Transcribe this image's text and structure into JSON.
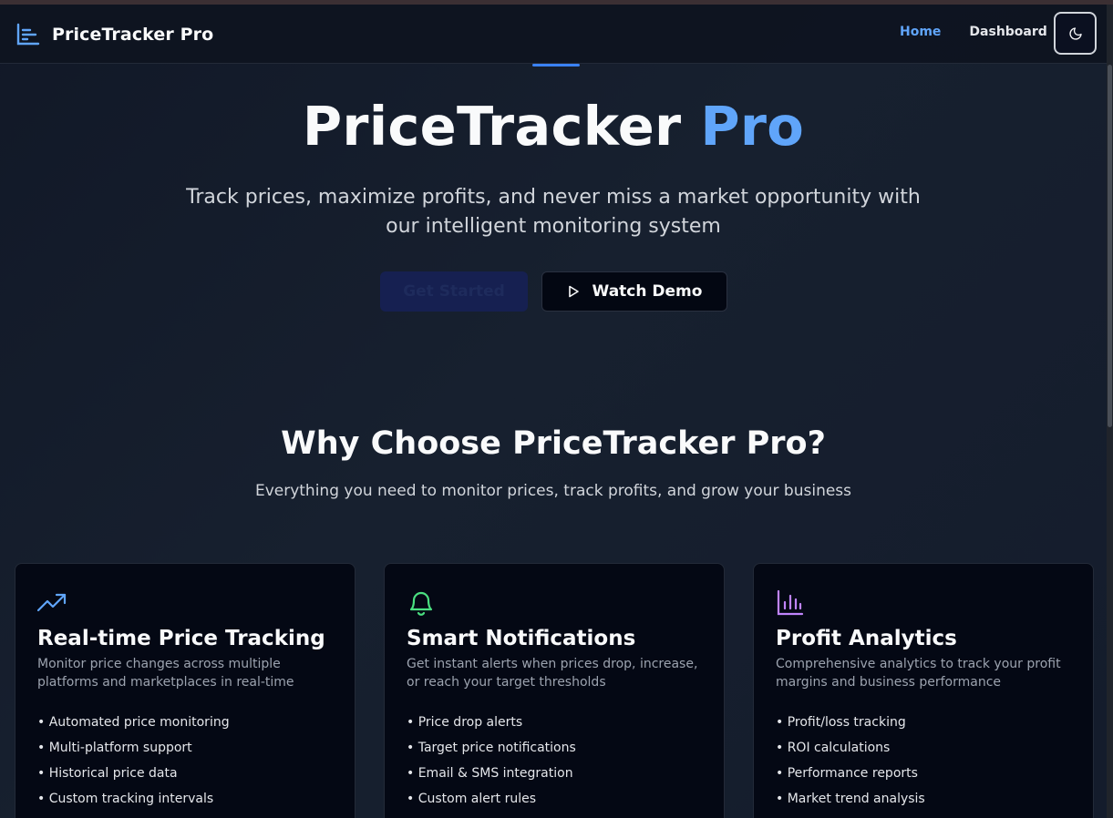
{
  "brand": {
    "name": "PriceTracker Pro"
  },
  "nav": {
    "home": "Home",
    "dashboard": "Dashboard"
  },
  "hero": {
    "title_main": "PriceTracker",
    "title_accent": "Pro",
    "subtitle": "Track prices, maximize profits, and never miss a market opportunity with our intelligent monitoring system",
    "cta_primary": "Get Started",
    "cta_secondary": "Watch Demo"
  },
  "features": {
    "title": "Why Choose PriceTracker Pro?",
    "subtitle": "Everything you need to monitor prices, track profits, and grow your business",
    "cards": [
      {
        "icon": "trending-up-icon",
        "title": "Real-time Price Tracking",
        "description": "Monitor price changes across multiple platforms and marketplaces in real-time",
        "items": [
          "• Automated price monitoring",
          "• Multi-platform support",
          "• Historical price data",
          "• Custom tracking intervals"
        ]
      },
      {
        "icon": "bell-icon",
        "title": "Smart Notifications",
        "description": "Get instant alerts when prices drop, increase, or reach your target thresholds",
        "items": [
          "• Price drop alerts",
          "• Target price notifications",
          "• Email & SMS integration",
          "• Custom alert rules"
        ]
      },
      {
        "icon": "bar-chart-icon",
        "title": "Profit Analytics",
        "description": "Comprehensive analytics to track your profit margins and business performance",
        "items": [
          "• Profit/loss tracking",
          "• ROI calculations",
          "• Performance reports",
          "• Market trend analysis"
        ]
      }
    ]
  },
  "colors": {
    "accent": "#60a5fa",
    "background": "#111827",
    "card_background": "#040814",
    "notification_icon": "#4ade80",
    "analytics_icon": "#c084fc"
  }
}
